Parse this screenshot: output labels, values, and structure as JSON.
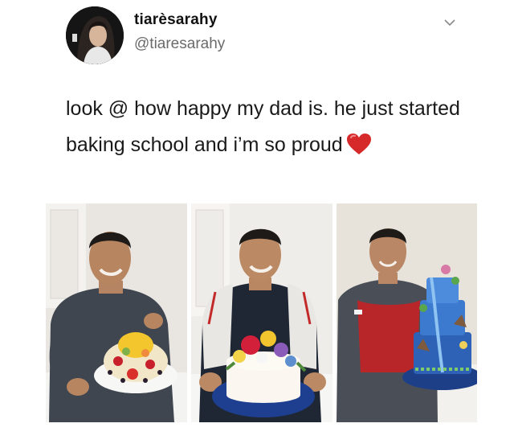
{
  "user": {
    "display_name": "tiarèsarahy",
    "handle": "@tiaresarahy"
  },
  "tweet": {
    "text": "look @ how happy my dad is. he just started baking school and i’m so proud",
    "emoji": "red-heart"
  },
  "icons": {
    "avatar": "profile-photo",
    "menu": "chevron-down-icon",
    "emoji": "red-heart-icon"
  },
  "photos": [
    {
      "subject": "man with fruit cake"
    },
    {
      "subject": "man with flower cake"
    },
    {
      "subject": "man in apron with blue tiered cake"
    }
  ],
  "colors": {
    "text": "#1a1a1a",
    "handle": "#6b6b6b",
    "heart": "#d62a2a"
  }
}
